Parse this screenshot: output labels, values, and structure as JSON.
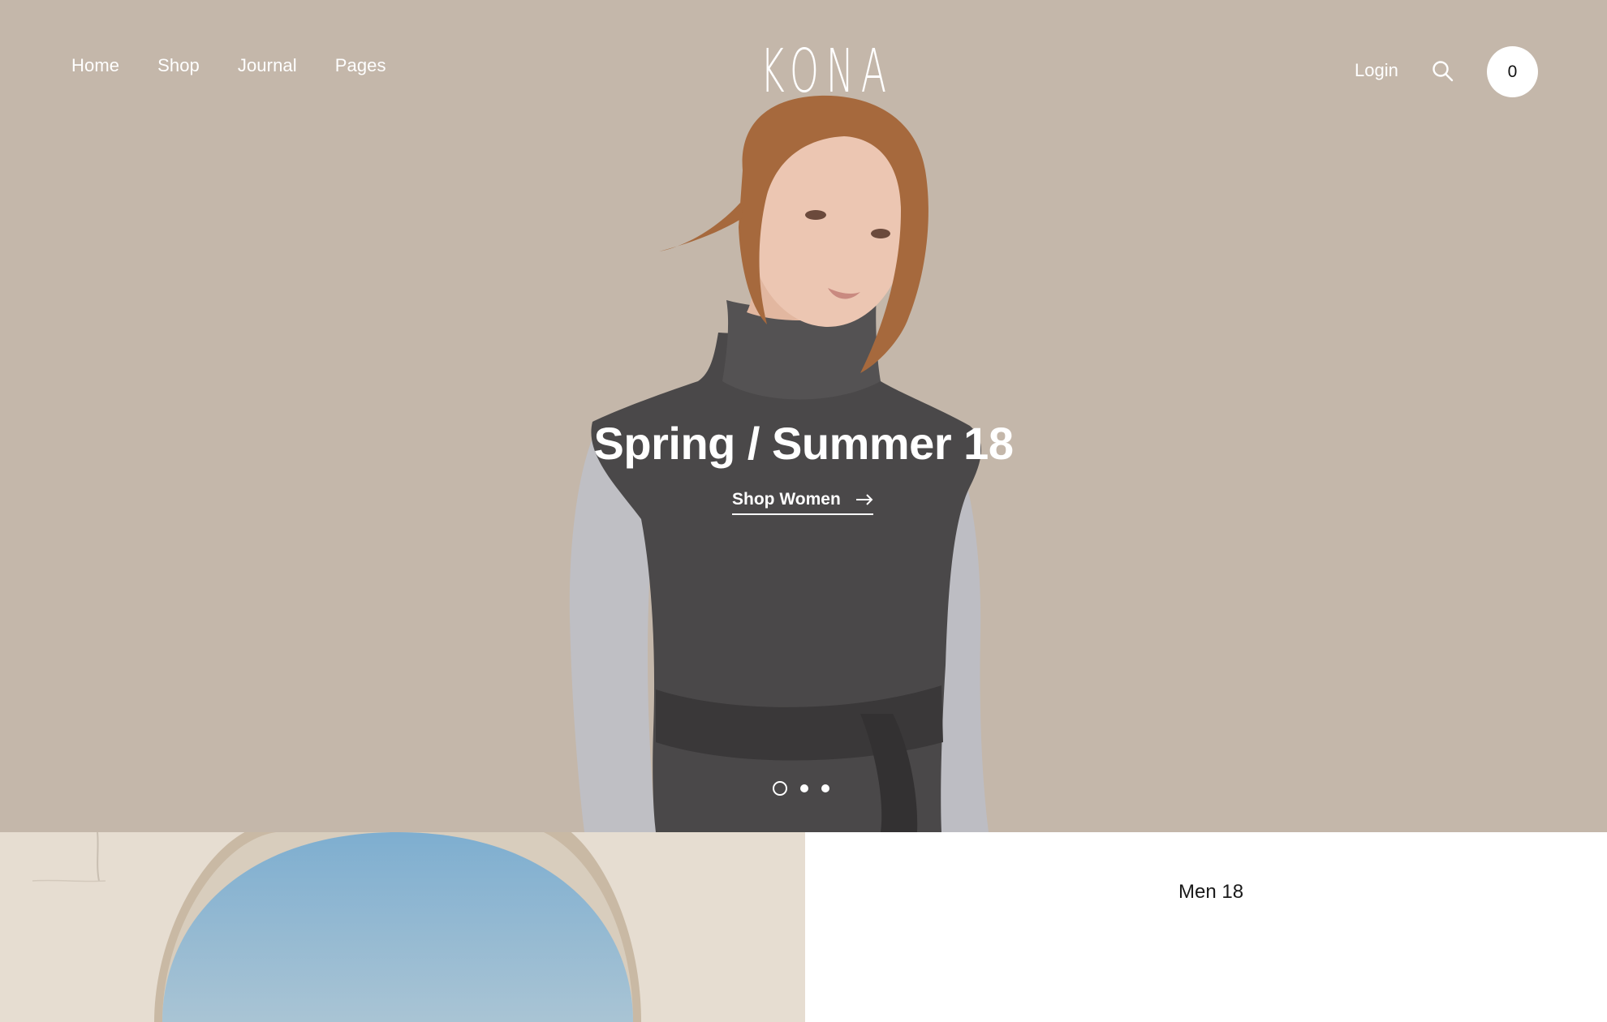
{
  "brand": {
    "logo_text": "KONA"
  },
  "nav": {
    "items": [
      {
        "label": "Home"
      },
      {
        "label": "Shop"
      },
      {
        "label": "Journal"
      },
      {
        "label": "Pages"
      }
    ]
  },
  "header": {
    "login_label": "Login",
    "search_icon": "search-icon",
    "cart_count": "0"
  },
  "hero": {
    "title": "Spring / Summer 18",
    "cta_label": "Shop Women",
    "cta_icon": "arrow-right-icon",
    "slides_total": 3,
    "active_slide": 1,
    "background_color": "#c4b7aa"
  },
  "promos": {
    "right_label": "Men 18"
  },
  "colors": {
    "text_on_hero": "#ffffff",
    "promo_left_bg": "#e6ddd1",
    "sky": "#8fb7cf"
  }
}
